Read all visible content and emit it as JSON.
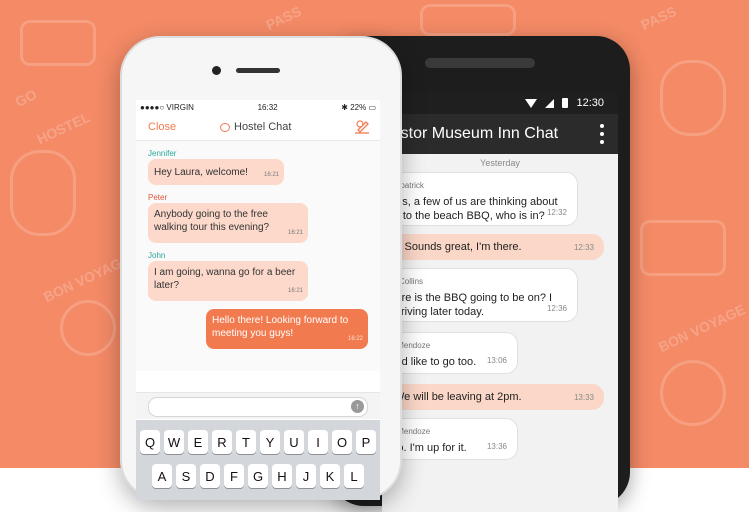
{
  "colors": {
    "accent": "#f27a4f",
    "background": "#f48a66",
    "incoming_bubble": "#fcd9cb",
    "android_toolbar": "#2b2b2b"
  },
  "android": {
    "status_time": "12:30",
    "toolbar_title": "Astor Museum Inn Chat",
    "day_label": "Yesterday",
    "messages": [
      {
        "sender": "ul Fitzpatrick",
        "text": "i guys, a few of us are thinking about oing to the beach BBQ, who is in?",
        "time": "12:32"
      },
      {
        "sender": "",
        "text": "Hi, Sounds great, I'm there.",
        "time": "12:33"
      },
      {
        "sender": "anna Collins",
        "text": "Where is the BBQ going to be on? I will rriving later today.",
        "time": "12:36"
      },
      {
        "sender": "ndre Mendoze",
        "text": "would like to go too.",
        "time": "13:06"
      },
      {
        "sender": "",
        "text": "We will be leaving at 2pm.",
        "time": "13:33"
      },
      {
        "sender": "ndre Mendoze",
        "text": "e too. I'm up for it.",
        "time": "13:36"
      }
    ]
  },
  "iphone": {
    "carrier": "VIRGIN",
    "status_time": "16:32",
    "battery": "22%",
    "close_label": "Close",
    "title": "Hostel Chat",
    "messages": [
      {
        "sender": "Jennifer",
        "sender_color": "#2aa89a",
        "text": "Hey Laura, welcome!",
        "time": "16:21"
      },
      {
        "sender": "Peter",
        "sender_color": "#e0553d",
        "text": "Anybody going to the free walking tour this evening?",
        "time": "16:21"
      },
      {
        "sender": "John",
        "sender_color": "#2aa89a",
        "text": "I am going, wanna go for a beer later?",
        "time": "16:21"
      },
      {
        "sender": "",
        "sender_color": "",
        "text": "Hello there! Looking forward to meeting you guys!",
        "time": "16:22"
      }
    ],
    "keyboard": {
      "row1": [
        "Q",
        "W",
        "E",
        "R",
        "T",
        "Y",
        "U",
        "I",
        "O",
        "P"
      ],
      "row2": [
        "A",
        "S",
        "D",
        "F",
        "G",
        "H",
        "J",
        "K",
        "L"
      ]
    }
  },
  "background_doodles": [
    "PASS",
    "HOSTEL",
    "BON VOYAGE",
    "GO",
    "PASS",
    "BON VOYAGE"
  ]
}
